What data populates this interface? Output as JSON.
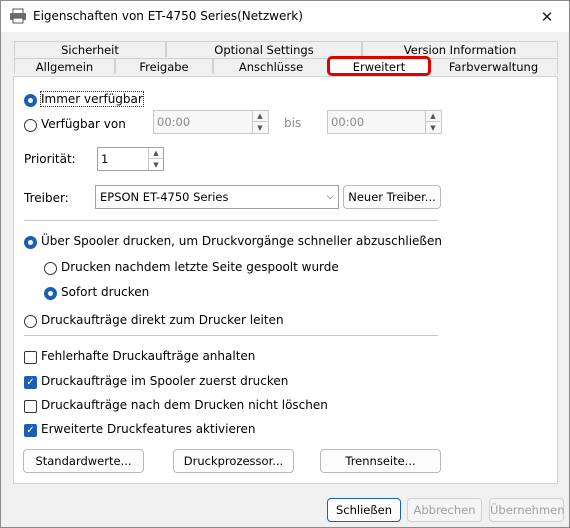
{
  "window": {
    "title": "Eigenschaften von ET-4750 Series(Netzwerk)",
    "close_glyph": "✕"
  },
  "tabs": {
    "row1": [
      "Sicherheit",
      "Optional Settings",
      "Version Information"
    ],
    "row2": [
      "Allgemein",
      "Freigabe",
      "Anschlüsse",
      "Erweitert",
      "Farbverwaltung"
    ],
    "active": "Erweitert",
    "highlight_color": "#e00000"
  },
  "availability": {
    "always_label": "Immer verfügbar",
    "from_label": "Verfügbar von",
    "from_value": "00:00",
    "bis_label": "bis",
    "to_value": "00:00",
    "selected": "always"
  },
  "priority": {
    "label": "Priorität:",
    "value": "1"
  },
  "driver": {
    "label": "Treiber:",
    "value": "EPSON ET-4750 Series",
    "new_button": "Neuer Treiber..."
  },
  "spool": {
    "spooler_label": "Über Spooler drucken, um Druckvorgänge schneller abzuschließen",
    "after_last_label": "Drucken nachdem letzte Seite gespoolt wurde",
    "immediate_label": "Sofort drucken",
    "direct_label": "Druckaufträge direkt zum Drucker leiten"
  },
  "checks": [
    {
      "label": "Fehlerhafte Druckaufträge anhalten",
      "checked": false
    },
    {
      "label": "Druckaufträge im Spooler zuerst drucken",
      "checked": true
    },
    {
      "label": "Druckaufträge nach dem Drucken nicht löschen",
      "checked": false
    },
    {
      "label": "Erweiterte Druckfeatures aktivieren",
      "checked": true
    }
  ],
  "panel_buttons": {
    "defaults": "Standardwerte...",
    "processor": "Druckprozessor...",
    "separator": "Trennseite..."
  },
  "footer": {
    "close": "Schließen",
    "cancel": "Abbrechen",
    "apply": "Übernehmen"
  },
  "accent_color": "#1a5fb4"
}
